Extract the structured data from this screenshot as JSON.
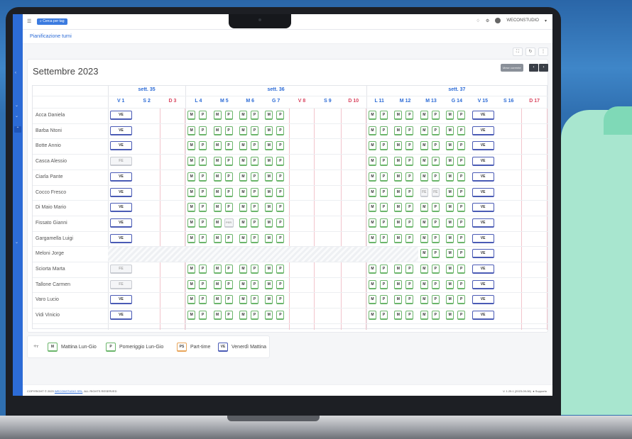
{
  "app": {
    "search_label": "Cerca per tag",
    "org": "WECONSTUDIO",
    "page_title": "Pianificazione turni"
  },
  "calendar": {
    "month_title": "Settembre 2023",
    "current_month_label": "Mese corrente",
    "prev": "‹",
    "next": "›"
  },
  "weeks": [
    {
      "label": "sett. 35",
      "from": 0,
      "span": 3
    },
    {
      "label": "sett. 36",
      "from": 3,
      "span": 7
    },
    {
      "label": "sett. 37",
      "from": 10,
      "span": 7
    }
  ],
  "days": [
    {
      "label": "V 1",
      "we": false
    },
    {
      "label": "S 2",
      "we": false
    },
    {
      "label": "D 3",
      "we": true
    },
    {
      "label": "L 4",
      "we": false
    },
    {
      "label": "M 5",
      "we": false
    },
    {
      "label": "M 6",
      "we": false
    },
    {
      "label": "G 7",
      "we": false
    },
    {
      "label": "V 8",
      "we": true
    },
    {
      "label": "S 9",
      "we": false
    },
    {
      "label": "D 10",
      "we": true
    },
    {
      "label": "L 11",
      "we": false
    },
    {
      "label": "M 12",
      "we": false
    },
    {
      "label": "M 13",
      "we": false
    },
    {
      "label": "G 14",
      "we": false
    },
    {
      "label": "V 15",
      "we": false
    },
    {
      "label": "S 16",
      "we": false
    },
    {
      "label": "D 17",
      "we": true
    }
  ],
  "employees": [
    {
      "name": "Acca Daniela",
      "d1": "VE",
      "wk36": [
        "MP",
        "MP",
        "MP",
        "MP"
      ],
      "wk37": [
        "MP",
        "MP",
        "MP",
        "MP"
      ],
      "v15": "VE"
    },
    {
      "name": "Barba Ntoni",
      "d1": "VE",
      "wk36": [
        "MP",
        "MP",
        "MP",
        "MP"
      ],
      "wk37": [
        "MP",
        "MP",
        "MP",
        "MP"
      ],
      "v15": "VE"
    },
    {
      "name": "Botte Annio",
      "d1": "VE",
      "wk36": [
        "MP",
        "MP",
        "MP",
        "MP"
      ],
      "wk37": [
        "MP",
        "MP",
        "MP",
        "MP"
      ],
      "v15": "VE"
    },
    {
      "name": "Casca Alessio",
      "d1": "FE",
      "wk36": [
        "MP",
        "MP",
        "MP",
        "MP"
      ],
      "wk37": [
        "MP",
        "MP",
        "MP",
        "MP"
      ],
      "v15": "VE"
    },
    {
      "name": "Ciarla Pante",
      "d1": "VE",
      "wk36": [
        "MP",
        "MP",
        "MP",
        "MP"
      ],
      "wk37": [
        "MP",
        "MP",
        "MP",
        "MP"
      ],
      "v15": "VE"
    },
    {
      "name": "Cocco Fresco",
      "d1": "VE",
      "wk36": [
        "MP",
        "MP",
        "MP",
        "MP"
      ],
      "wk37": [
        "MP",
        "MP",
        "FEFE",
        "MP"
      ],
      "v15": "VE"
    },
    {
      "name": "Di Maio Mario",
      "d1": "VE",
      "wk36": [
        "MP",
        "MP",
        "MP",
        "MP"
      ],
      "wk37": [
        "MP",
        "MP",
        "MP",
        "MP"
      ],
      "v15": "VE"
    },
    {
      "name": "Fissato Gianni",
      "d1": "VE",
      "wk36": [
        "MP",
        "MPER",
        "MP",
        "MP"
      ],
      "wk37": [
        "MP",
        "MP",
        "MP",
        "MP"
      ],
      "v15": "VE"
    },
    {
      "name": "Gargamella Luigi",
      "d1": "VE",
      "wk36": [
        "MP",
        "MP",
        "MP",
        "MP"
      ],
      "wk37": [
        "MP",
        "MP",
        "MP",
        "MP"
      ],
      "v15": "VE"
    },
    {
      "name": "Meloni Jorge",
      "d1": "",
      "wk36": [
        "",
        "",
        "",
        ""
      ],
      "wk37": [
        "",
        "",
        "MP",
        "MP"
      ],
      "v15": "VE",
      "hatch": true
    },
    {
      "name": "Sciorta Marta",
      "d1": "FE",
      "wk36": [
        "MP",
        "MP",
        "MP",
        "MP"
      ],
      "wk37": [
        "MP",
        "MP",
        "MP",
        "MP"
      ],
      "v15": "VE"
    },
    {
      "name": "Tallone Carmen",
      "d1": "FE",
      "wk36": [
        "MP",
        "MP",
        "MP",
        "MP"
      ],
      "wk37": [
        "MP",
        "MP",
        "MP",
        "MP"
      ],
      "v15": "VE"
    },
    {
      "name": "Varo Lucio",
      "d1": "VE",
      "wk36": [
        "MP",
        "MP",
        "MP",
        "MP"
      ],
      "wk37": [
        "MP",
        "MP",
        "MP",
        "MP"
      ],
      "v15": "VE"
    },
    {
      "name": "Vidi Vinicio",
      "d1": "VE",
      "wk36": [
        "MP",
        "MP",
        "MP",
        "MP"
      ],
      "wk37": [
        "MP",
        "MP",
        "MP",
        "MP"
      ],
      "v15": "VE"
    }
  ],
  "legend": [
    {
      "code": "M",
      "label": "Mattina Lun-Gio",
      "color": "#6bb56b"
    },
    {
      "code": "P",
      "label": "Pomeriggio Lun-Gio",
      "color": "#6bb56b"
    },
    {
      "code": "PS",
      "label": "Part-time",
      "color": "#e8a55a"
    },
    {
      "code": "VE",
      "label": "Venerdì Mattina",
      "color": "#4a5bb5"
    }
  ],
  "footer": {
    "copyright": "COPYRIGHT © 2023",
    "company_link": "WECONSTUDIO SRL",
    "rights": ", ALL RIGHTS RESERVED",
    "version": "V. 1.25.1 (2023-09-06)",
    "support": "Supporto"
  }
}
